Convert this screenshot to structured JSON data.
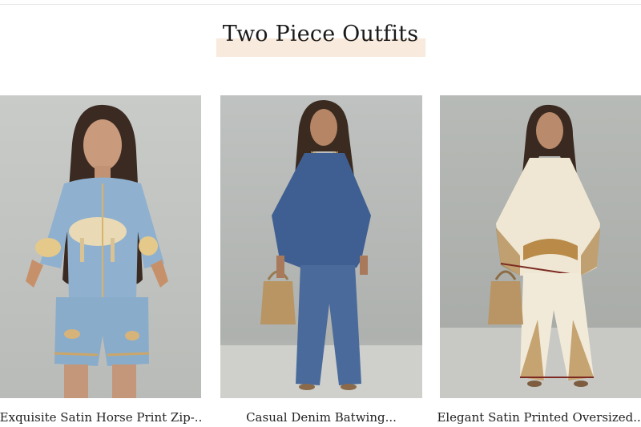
{
  "section": {
    "title": "Two Piece Outfits"
  },
  "products": [
    {
      "name": "Exquisite Satin Horse Print Zip-..",
      "image": "model in light blue satin horse print zip jacket and shorts"
    },
    {
      "name": "Casual Denim Batwing...",
      "image": "model in denim batwing top and wide leg pants with straw bag"
    },
    {
      "name": "Elegant Satin Printed Oversized...",
      "image": "model in cream satin paisley print oversized top and pants"
    }
  ],
  "colors": {
    "highlight": "#f8eadc",
    "text": "#222222"
  }
}
